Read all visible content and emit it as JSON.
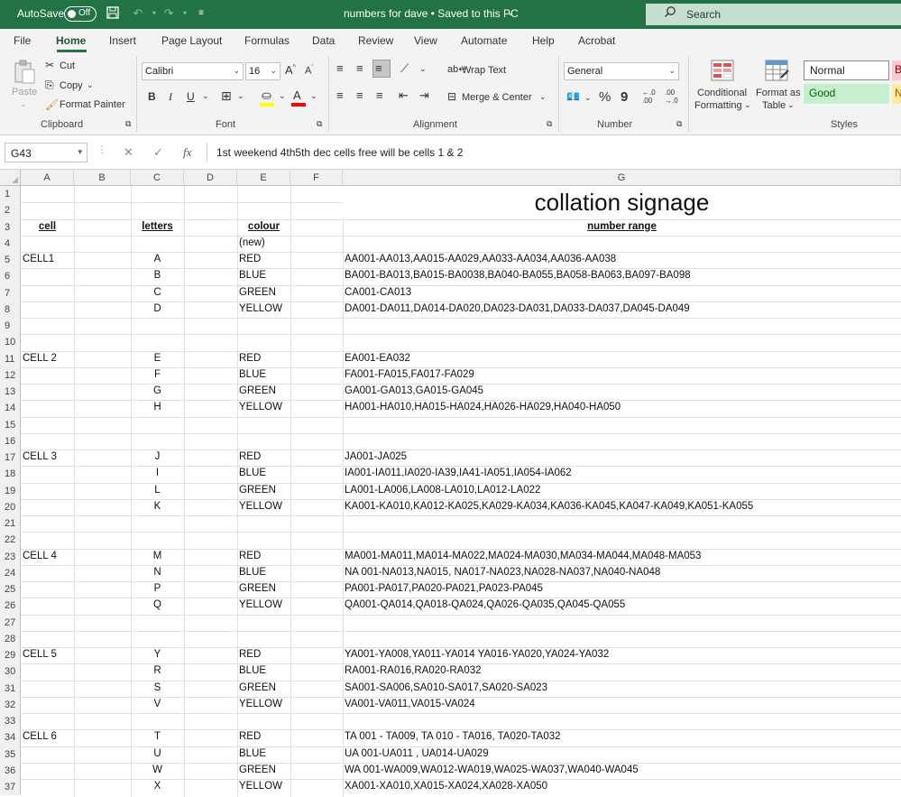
{
  "titlebar": {
    "autosave_label": "AutoSave",
    "autosave_state": "Off",
    "doc_title": "numbers for dave • Saved to this PC",
    "search_placeholder": "Search"
  },
  "menu": [
    "File",
    "Home",
    "Insert",
    "Page Layout",
    "Formulas",
    "Data",
    "Review",
    "View",
    "Automate",
    "Help",
    "Acrobat"
  ],
  "ribbon": {
    "clipboard": {
      "paste": "Paste",
      "cut": "Cut",
      "copy": "Copy",
      "format_painter": "Format Painter",
      "group": "Clipboard"
    },
    "font": {
      "name": "Calibri",
      "size": "16",
      "group": "Font",
      "bold": "B",
      "italic": "I",
      "underline": "U"
    },
    "alignment": {
      "wrap_text": "Wrap Text",
      "merge_center": "Merge & Center",
      "group": "Alignment"
    },
    "number": {
      "format": "General",
      "group": "Number",
      "percent": "%",
      "comma": "9",
      "inc_decimal": "←.00\n.0",
      "dec_decimal": ".00\n→.0"
    },
    "styles": {
      "conditional_1": "Conditional",
      "conditional_2": "Formatting",
      "format_table_1": "Format as",
      "format_table_2": "Table",
      "normal": "Normal",
      "good": "Good",
      "group": "Styles"
    },
    "colors": {
      "fill": "#ffff00",
      "font": "#ff0000",
      "good_bg": "#c6efce",
      "good_text": "#006100"
    }
  },
  "formula_bar": {
    "name_box": "G43",
    "fx": "fx",
    "content": "1st weekend 4th5th dec  cells free will be  cells 1 & 2"
  },
  "columns": [
    "A",
    "B",
    "C",
    "D",
    "E",
    "F",
    "G"
  ],
  "rows": [
    "1",
    "2",
    "3",
    "4",
    "5",
    "6",
    "7",
    "8",
    "9",
    "10",
    "11",
    "12",
    "13",
    "14",
    "15",
    "16",
    "17",
    "18",
    "19",
    "20",
    "21",
    "22",
    "23",
    "24",
    "25",
    "26",
    "27",
    "28",
    "29",
    "30",
    "31",
    "32",
    "33",
    "34",
    "35",
    "36",
    "37"
  ],
  "sheet": {
    "title": "collation signage",
    "headers": {
      "cell": "cell",
      "letters": "letters",
      "colour": "colour",
      "number_range": "number range"
    },
    "colour_note": "(new)",
    "groups": [
      {
        "cell": "CELL1",
        "items": [
          {
            "letter": "A",
            "colour": "RED",
            "range": "AA001-AA013,AA015-AA029,AA033-AA034,AA036-AA038"
          },
          {
            "letter": "B",
            "colour": "BLUE",
            "range": "BA001-BA013,BA015-BA0038,BA040-BA055,BA058-BA063,BA097-BA098"
          },
          {
            "letter": "C",
            "colour": "GREEN",
            "range": "CA001-CA013"
          },
          {
            "letter": "D",
            "colour": "YELLOW",
            "range": "DA001-DA011,DA014-DA020,DA023-DA031,DA033-DA037,DA045-DA049"
          }
        ]
      },
      {
        "cell": "CELL 2",
        "items": [
          {
            "letter": "E",
            "colour": "RED",
            "range": "EA001-EA032"
          },
          {
            "letter": "F",
            "colour": "BLUE",
            "range": "FA001-FA015,FA017-FA029"
          },
          {
            "letter": "G",
            "colour": "GREEN",
            "range": "GA001-GA013,GA015-GA045"
          },
          {
            "letter": "H",
            "colour": "YELLOW",
            "range": "HA001-HA010,HA015-HA024,HA026-HA029,HA040-HA050"
          }
        ]
      },
      {
        "cell": "CELL 3",
        "items": [
          {
            "letter": "J",
            "colour": "RED",
            "range": "JA001-JA025"
          },
          {
            "letter": "I",
            "colour": "BLUE",
            "range": "IA001-IA011,IA020-IA39,IA41-IA051,IA054-IA062"
          },
          {
            "letter": "L",
            "colour": "GREEN",
            "range": "LA001-LA006,LA008-LA010,LA012-LA022"
          },
          {
            "letter": "K",
            "colour": "YELLOW",
            "range": "KA001-KA010,KA012-KA025,KA029-KA034,KA036-KA045,KA047-KA049,KA051-KA055"
          }
        ]
      },
      {
        "cell": "CELL 4",
        "items": [
          {
            "letter": "M",
            "colour": "RED",
            "range": "MA001-MA011,MA014-MA022,MA024-MA030,MA034-MA044,MA048-MA053"
          },
          {
            "letter": "N",
            "colour": "BLUE",
            "range": "NA 001-NA013,NA015, NA017-NA023,NA028-NA037,NA040-NA048"
          },
          {
            "letter": "P",
            "colour": "GREEN",
            "range": "PA001-PA017,PA020-PA021,PA023-PA045"
          },
          {
            "letter": "Q",
            "colour": "YELLOW",
            "range": "QA001-QA014,QA018-QA024,QA026-QA035,QA045-QA055"
          }
        ]
      },
      {
        "cell": "CELL 5",
        "items": [
          {
            "letter": "Y",
            "colour": "RED",
            "range": "YA001-YA008,YA011-YA014 YA016-YA020,YA024-YA032"
          },
          {
            "letter": "R",
            "colour": "BLUE",
            "range": "RA001-RA016,RA020-RA032"
          },
          {
            "letter": "S",
            "colour": "GREEN",
            "range": "SA001-SA006,SA010-SA017,SA020-SA023"
          },
          {
            "letter": "V",
            "colour": "YELLOW",
            "range": "VA001-VA011,VA015-VA024"
          }
        ]
      },
      {
        "cell": "CELL 6",
        "items": [
          {
            "letter": "T",
            "colour": "RED",
            "range": "TA 001 - TA009, TA 010 - TA016, TA020-TA032"
          },
          {
            "letter": "U",
            "colour": "BLUE",
            "range": "UA 001-UA011 , UA014-UA029"
          },
          {
            "letter": "W",
            "colour": "GREEN",
            "range": "WA 001-WA009,WA012-WA019,WA025-WA037,WA040-WA045"
          },
          {
            "letter": "X",
            "colour": "YELLOW",
            "range": "XA001-XA010,XA015-XA024,XA028-XA050"
          }
        ]
      }
    ]
  }
}
